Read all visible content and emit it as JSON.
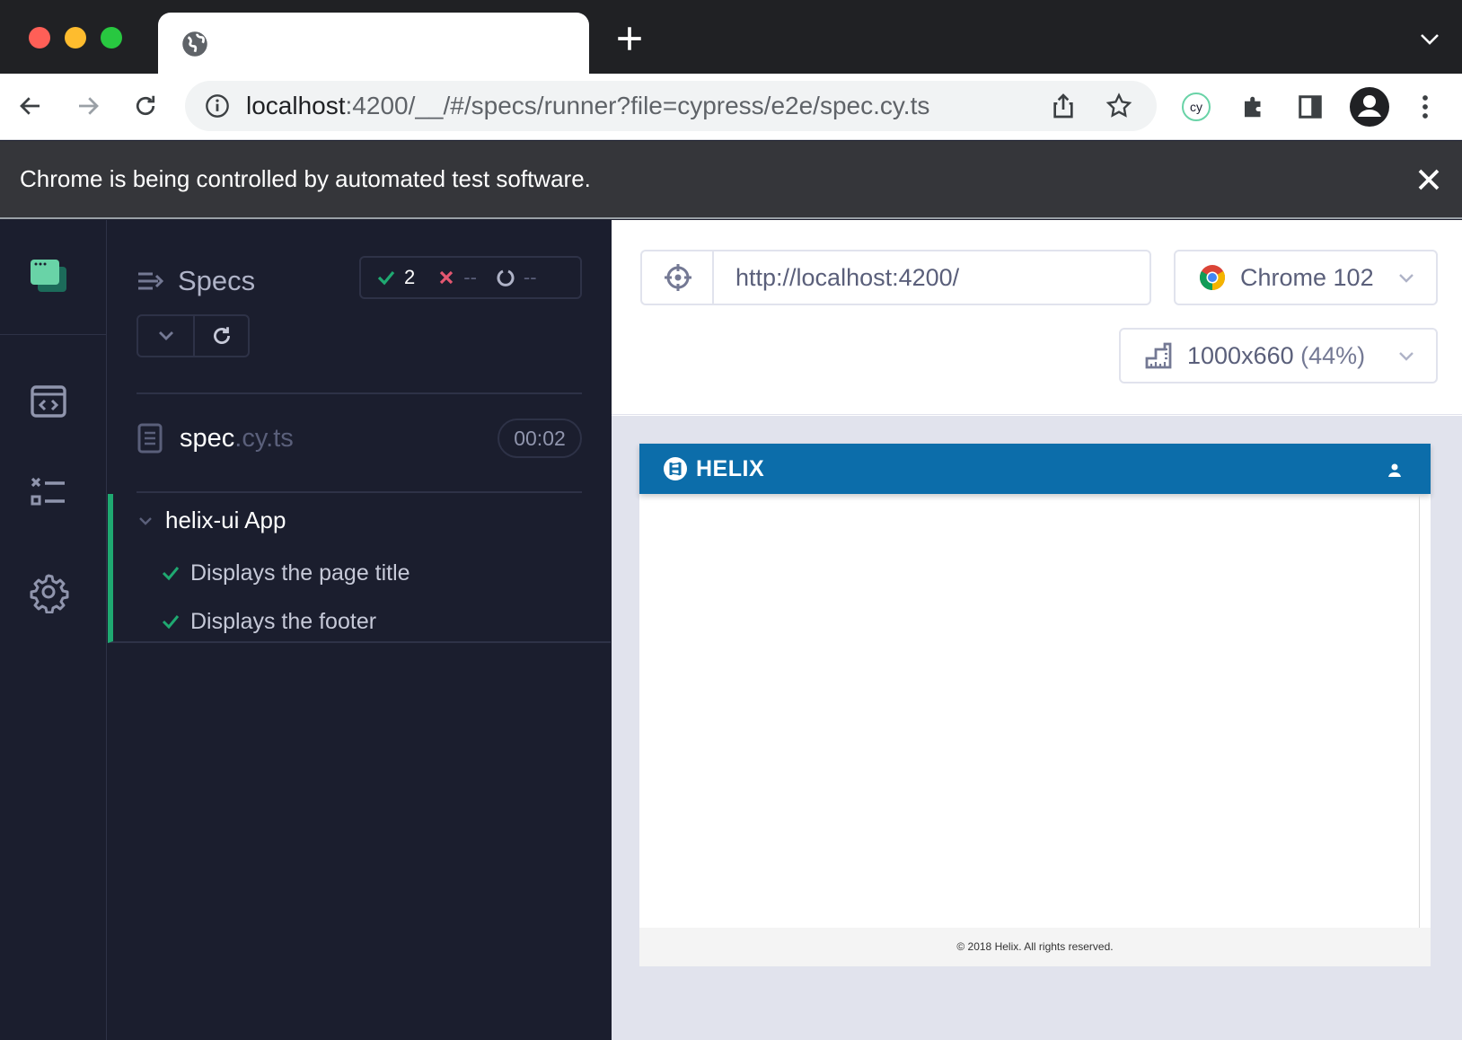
{
  "browser": {
    "address": {
      "host": "localhost",
      "rest": ":4200/__/#/specs/runner?file=cypress/e2e/spec.cy.ts"
    },
    "infobar_text": "Chrome is being controlled by automated test software.",
    "extension_label": "cy"
  },
  "reporter": {
    "specs_title": "Specs",
    "stats": {
      "passed": "2",
      "failed": "--",
      "pending": "--"
    },
    "spec": {
      "name": "spec",
      "ext": ".cy.ts",
      "duration": "00:02"
    },
    "suite": {
      "title": "helix-ui App",
      "tests": [
        {
          "label": "Displays the page title",
          "state": "passed"
        },
        {
          "label": "Displays the footer",
          "state": "passed"
        }
      ]
    }
  },
  "aut": {
    "url": "http://localhost:4200/",
    "browser_name": "Chrome 102",
    "viewport": "1000x660",
    "scale": "(44%)",
    "app": {
      "brand": "HELIX",
      "footer": "© 2018 Helix. All rights reserved."
    }
  },
  "colors": {
    "pass": "#1fa971",
    "fail": "#e45770",
    "brand_bar": "#0c6daa"
  }
}
